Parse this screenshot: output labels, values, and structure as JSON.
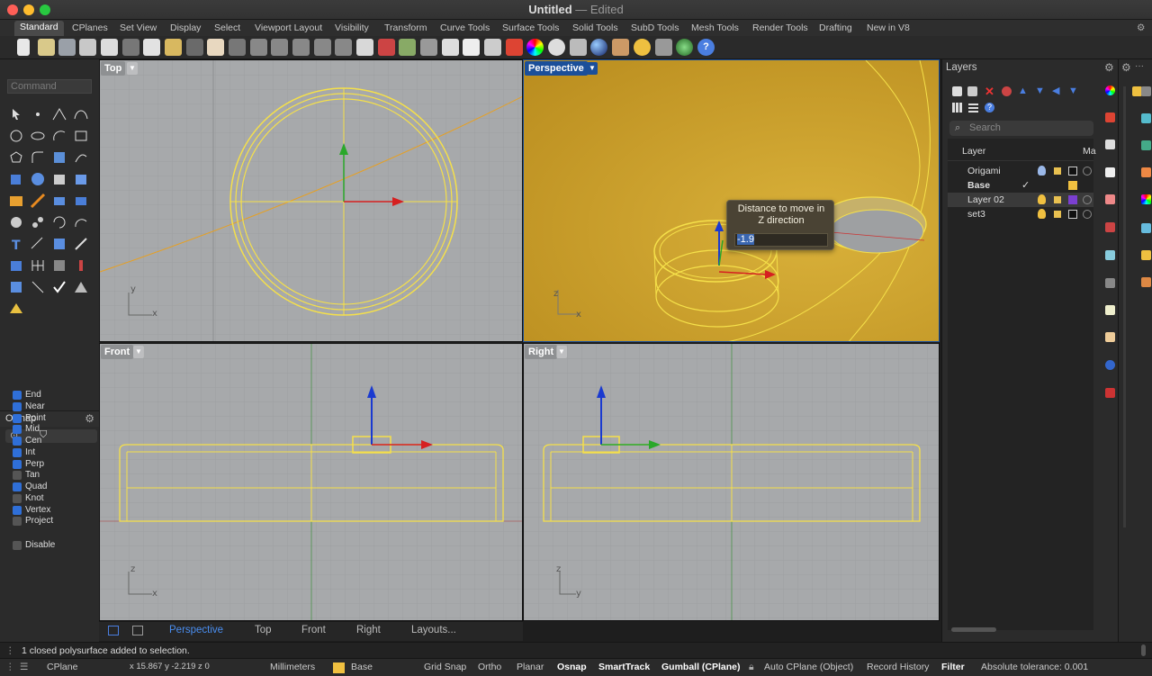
{
  "window": {
    "title": "Untitled",
    "edited": "— Edited"
  },
  "tabs": [
    "Standard",
    "CPlanes",
    "Set View",
    "Display",
    "Select",
    "Viewport Layout",
    "Visibility",
    "Transform",
    "Curve Tools",
    "Surface Tools",
    "Solid Tools",
    "SubD Tools",
    "Mesh Tools",
    "Render Tools",
    "Drafting",
    "New in V8"
  ],
  "command": {
    "placeholder": "Command"
  },
  "osnap": {
    "title": "OSnap",
    "items": [
      {
        "label": "End",
        "checked": true
      },
      {
        "label": "Near",
        "checked": true
      },
      {
        "label": "Point",
        "checked": true
      },
      {
        "label": "Mid",
        "checked": true
      },
      {
        "label": "Cen",
        "checked": true
      },
      {
        "label": "Int",
        "checked": true
      },
      {
        "label": "Perp",
        "checked": true
      },
      {
        "label": "Tan",
        "checked": false
      },
      {
        "label": "Quad",
        "checked": true
      },
      {
        "label": "Knot",
        "checked": false
      },
      {
        "label": "Vertex",
        "checked": true
      },
      {
        "label": "Project",
        "checked": false
      }
    ],
    "disable": "Disable"
  },
  "viewports": {
    "top": {
      "label": "Top",
      "axis_h": "x",
      "axis_v": "y"
    },
    "perspective": {
      "label": "Perspective",
      "axis_h": "x",
      "axis_v": "z"
    },
    "front": {
      "label": "Front",
      "axis_h": "x",
      "axis_v": "z"
    },
    "right": {
      "label": "Right",
      "axis_h": "y",
      "axis_v": "z"
    }
  },
  "tooltip": {
    "line1": "Distance to move in",
    "line2": "Z direction",
    "value": "-1.9"
  },
  "viewport_tabs": [
    "Perspective",
    "Top",
    "Front",
    "Right",
    "Layouts..."
  ],
  "layers": {
    "title": "Layers",
    "search_placeholder": "Search",
    "col_layer": "Layer",
    "col_mat": "Ma",
    "rows": [
      {
        "name": "Origami",
        "color": "#111111"
      },
      {
        "name": "Base",
        "color": "#f0c040",
        "current": true
      },
      {
        "name": "Layer 02",
        "color": "#7b3fd0"
      },
      {
        "name": "set3",
        "color": "#111111"
      }
    ]
  },
  "status_message": "1 closed polysurface added to selection.",
  "statusbar": {
    "cplane": "CPlane",
    "coords": "x 15.867  y -2.219  z 0",
    "units": "Millimeters",
    "layer": "Base",
    "grid_snap": "Grid Snap",
    "ortho": "Ortho",
    "planar": "Planar",
    "osnap": "Osnap",
    "smarttrack": "SmartTrack",
    "gumball": "Gumball (CPlane)",
    "auto_cplane": "Auto CPlane (Object)",
    "record_history": "Record History",
    "filter": "Filter",
    "tolerance": "Absolute tolerance: 0.001"
  },
  "colors": {
    "accent": "#2f6fd8",
    "object_yellow": "#f5e04a",
    "persp_bg": "#c49a28"
  }
}
